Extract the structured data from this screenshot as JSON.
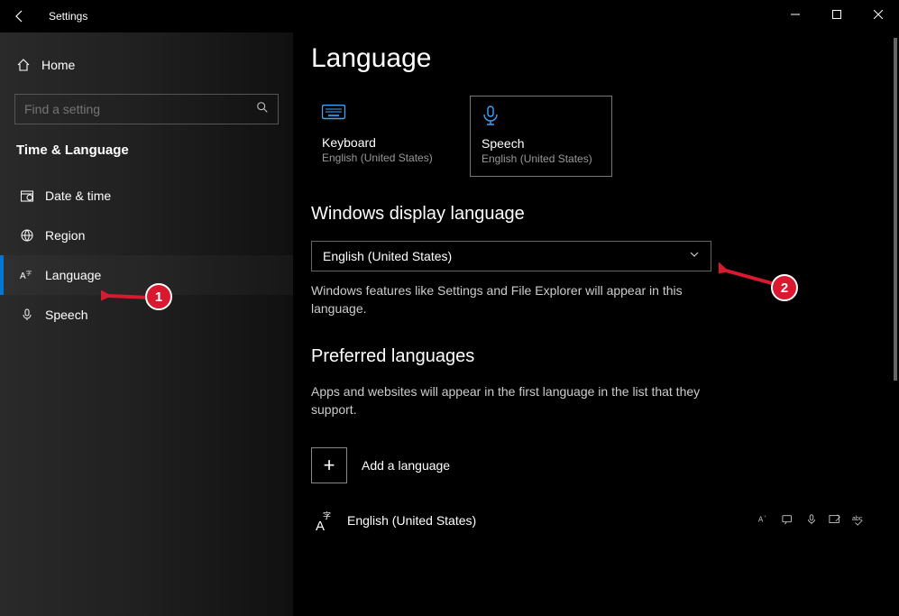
{
  "titlebar": {
    "title": "Settings"
  },
  "sidebar": {
    "home": "Home",
    "search_placeholder": "Find a setting",
    "category": "Time & Language",
    "items": [
      {
        "label": "Date & time"
      },
      {
        "label": "Region"
      },
      {
        "label": "Language"
      },
      {
        "label": "Speech"
      }
    ]
  },
  "main": {
    "heading": "Language",
    "tiles": {
      "keyboard": {
        "label": "Keyboard",
        "sub": "English (United States)"
      },
      "speech": {
        "label": "Speech",
        "sub": "English (United States)"
      }
    },
    "display_lang_heading": "Windows display language",
    "display_lang_value": "English (United States)",
    "display_lang_desc": "Windows features like Settings and File Explorer will appear in this language.",
    "preferred_heading": "Preferred languages",
    "preferred_desc": "Apps and websites will appear in the first language in the list that they support.",
    "add_language": "Add a language",
    "languages": [
      {
        "name": "English (United States)"
      }
    ]
  },
  "annotations": {
    "badge1": "1",
    "badge2": "2"
  }
}
